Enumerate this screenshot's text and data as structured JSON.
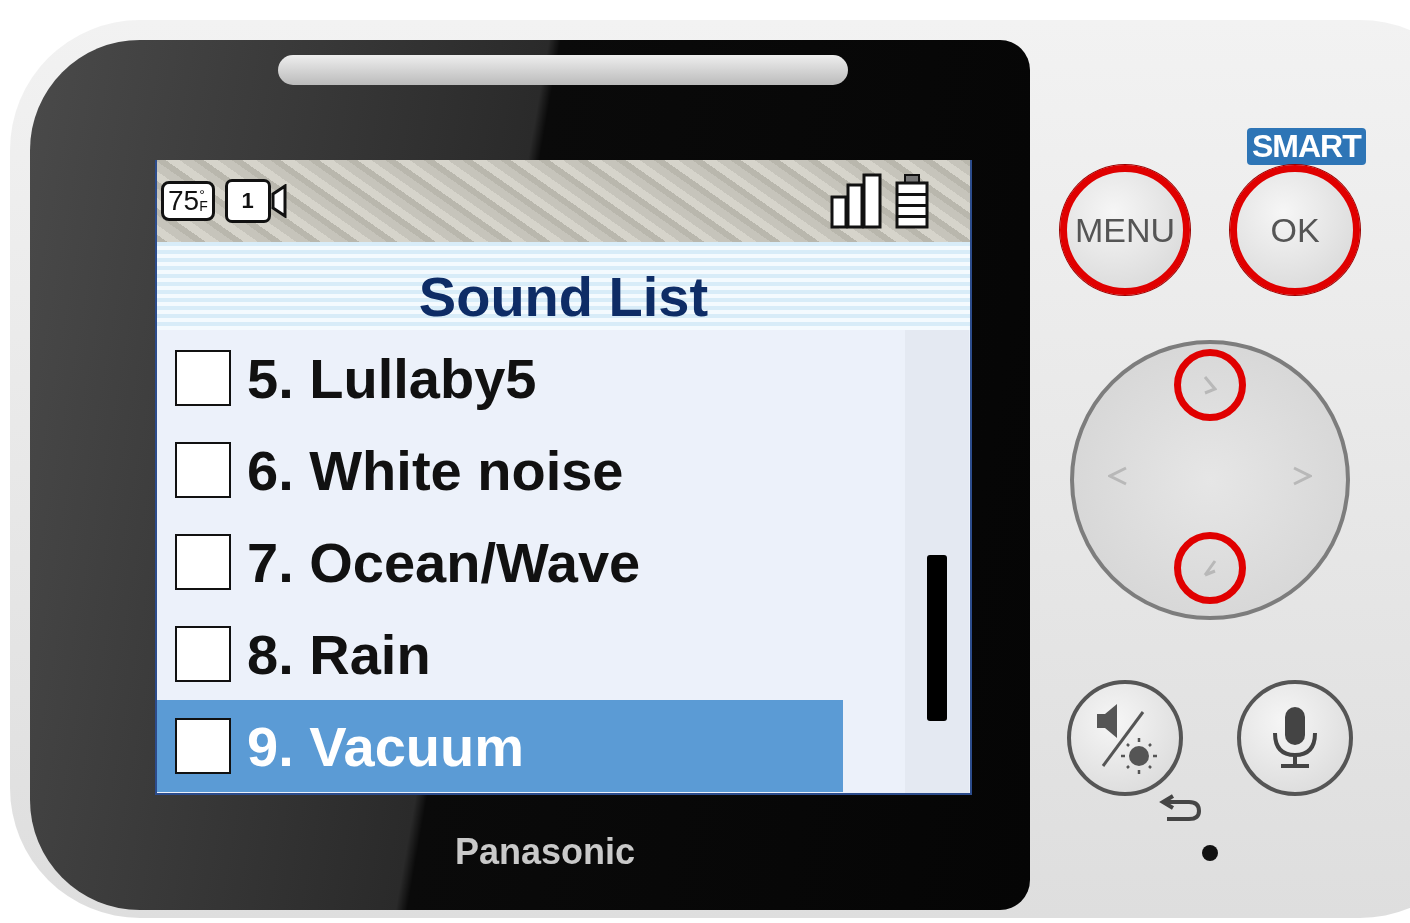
{
  "status": {
    "temperature": "75",
    "degree": "°",
    "unit": "F",
    "camera_number": "1"
  },
  "title": "Sound List",
  "items": [
    {
      "label": "5. Lullaby5",
      "checked": false,
      "selected": false
    },
    {
      "label": "6. White noise",
      "checked": false,
      "selected": false
    },
    {
      "label": "7. Ocean/Wave",
      "checked": false,
      "selected": false
    },
    {
      "label": "8. Rain",
      "checked": false,
      "selected": false
    },
    {
      "label": "9. Vacuum",
      "checked": false,
      "selected": true
    }
  ],
  "brand": "Panasonic",
  "smart_label": "SMART",
  "buttons": [
    {
      "label": "MENU",
      "highlighted": true
    },
    {
      "label": "OK",
      "highlighted": true
    }
  ],
  "dpad": [
    {
      "kind": "up",
      "highlighted": true
    },
    {
      "kind": "left",
      "highlighted": false
    },
    {
      "kind": "right",
      "highlighted": false
    },
    {
      "kind": "down",
      "highlighted": true
    }
  ]
}
